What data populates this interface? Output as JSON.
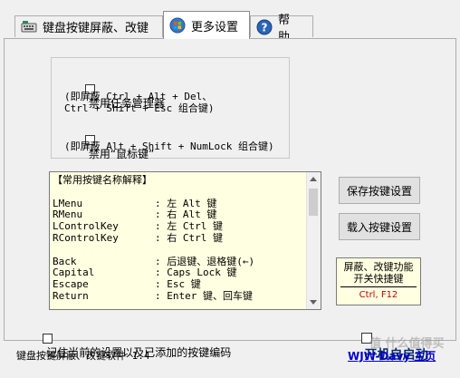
{
  "tabs": [
    {
      "label": "键盘按键屏蔽、改键",
      "icon": "keyboard-icon"
    },
    {
      "label": "更多设置",
      "icon": "windows-orb-icon"
    },
    {
      "label": "帮 助",
      "icon": "help-icon"
    }
  ],
  "options": {
    "task_manager": {
      "label": "禁用任务管理器",
      "note1": "(即屏蔽 Ctrl + Alt + Del、",
      "note2": "Ctrl + Shift + Esc 组合键)",
      "checked": false
    },
    "mouse_keys": {
      "label": "禁用“鼠标键”",
      "note": "(即屏蔽 Alt + Shift + NumLock 组合键)",
      "checked": false
    }
  },
  "key_list": {
    "header": "【常用按键名称解释】",
    "rows": [
      {
        "key": "",
        "desc": ""
      },
      {
        "key": "LMenu",
        "desc": ": 左 Alt 键"
      },
      {
        "key": "RMenu",
        "desc": ": 右 Alt 键"
      },
      {
        "key": "LControlKey",
        "desc": ": 左 Ctrl 键"
      },
      {
        "key": "RControlKey",
        "desc": ": 右 Ctrl 键"
      },
      {
        "key": "",
        "desc": ""
      },
      {
        "key": "Back",
        "desc": ": 后退键、退格键(←)"
      },
      {
        "key": "Capital",
        "desc": ": Caps Lock 键"
      },
      {
        "key": "Escape",
        "desc": ": Esc 键"
      },
      {
        "key": "Return",
        "desc": ": Enter 键、回车键"
      }
    ]
  },
  "buttons": {
    "save": "保存按键设置",
    "load": "载入按键设置"
  },
  "hotkey": {
    "title_line1": "屏蔽、改键功能",
    "title_line2": "开关快捷键",
    "key": "Ctrl, F12"
  },
  "remember": {
    "label": "记住当前的设置以及已添加的按键编码",
    "checked": false
  },
  "autostart": {
    "label": "开机自启动",
    "checked": false
  },
  "footer": {
    "version": "键盘按键屏蔽、改键软件 1.4",
    "link": "WJW-Davy 主页",
    "watermark": "值 什么值得买"
  }
}
